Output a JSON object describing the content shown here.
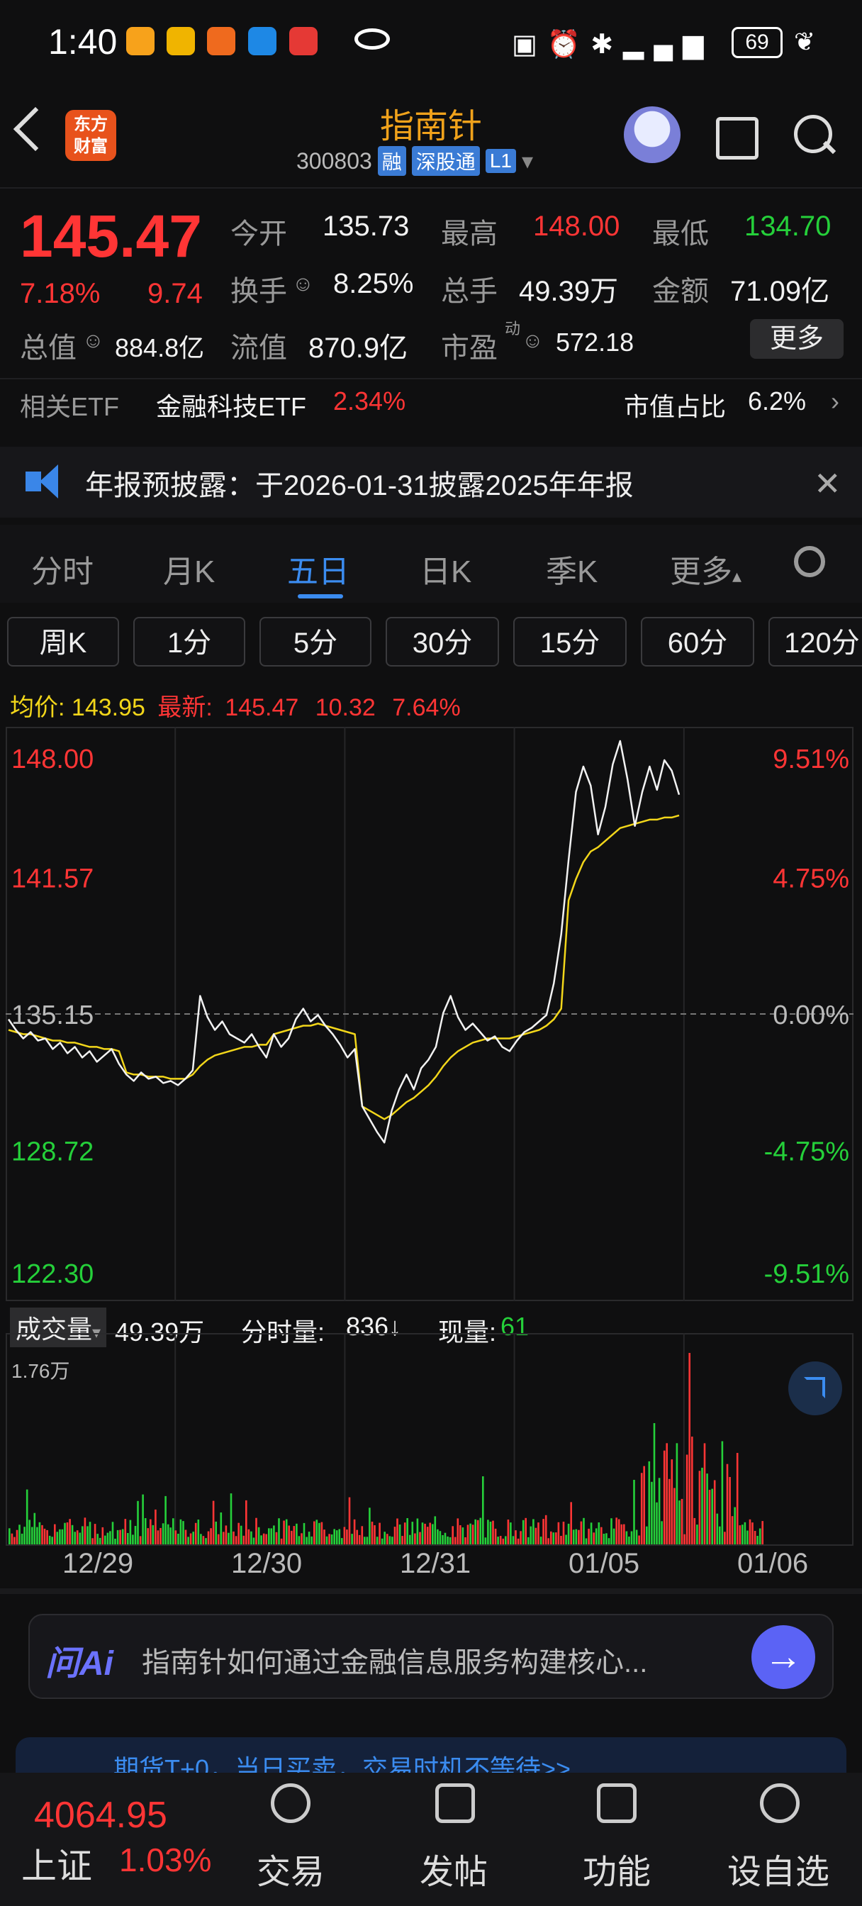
{
  "status_bar": {
    "time": "1:40",
    "battery": "69",
    "icons": [
      "nfc-icon",
      "alarm-icon",
      "bluetooth-icon",
      "signal-icon",
      "signal-icon",
      "leaf-icon"
    ]
  },
  "header": {
    "app_logo": "东方\n财富",
    "stock_name": "指南针",
    "stock_code": "300803",
    "tags": [
      "融",
      "深股通",
      "L1"
    ]
  },
  "quote": {
    "price": "145.47",
    "change_pct": "7.18%",
    "change": "9.74",
    "open_label": "今开",
    "open": "135.73",
    "high_label": "最高",
    "high": "148.00",
    "low_label": "最低",
    "low": "134.70",
    "turnover_label": "换手",
    "turnover": "8.25%",
    "volume_label": "总手",
    "volume": "49.39万",
    "amount_label": "金额",
    "amount": "71.09亿",
    "mcap_label": "总值",
    "mcap": "884.8亿",
    "float_label": "流值",
    "float": "870.9亿",
    "pe_label": "市盈",
    "pe_sup": "动",
    "pe": "572.18",
    "more": "更多"
  },
  "etf": {
    "label": "相关ETF",
    "name": "金融科技ETF",
    "pct": "2.34%",
    "share_label": "市值占比",
    "share": "6.2%"
  },
  "notice": {
    "text": "年报预披露：于2026-01-31披露2025年年报"
  },
  "tabs": [
    "分时",
    "月K",
    "五日",
    "日K",
    "季K",
    "更多"
  ],
  "active_tab": "五日",
  "periods": [
    "周K",
    "1分",
    "5分",
    "30分",
    "15分",
    "60分",
    "120分"
  ],
  "avg": {
    "avg_label": "均价:",
    "avg": "143.95",
    "latest_label": "最新:",
    "latest": "145.47",
    "chg": "10.32",
    "pct": "7.64%"
  },
  "chart_data": {
    "type": "line",
    "title": "",
    "price_ticks": [
      "148.00",
      "141.57",
      "135.15",
      "128.72",
      "122.30"
    ],
    "pct_ticks": [
      "9.51%",
      "4.75%",
      "0.00%",
      "-4.75%",
      "-9.51%"
    ],
    "ylim": [
      122.3,
      148.0
    ],
    "ref_price": 135.15,
    "days": [
      "12/29",
      "12/30",
      "12/31",
      "01/05",
      "01/06"
    ],
    "series": [
      {
        "values": [
          134.9,
          134.4,
          134.0,
          134.3,
          133.9,
          134.0,
          133.5,
          133.8,
          133.3,
          133.6,
          133.1,
          133.4,
          132.9,
          133.2,
          133.5,
          132.8,
          132.3,
          132.0,
          132.4,
          132.1,
          132.2,
          131.9,
          132.0,
          131.8,
          132.1,
          132.5,
          136.0,
          135.0,
          134.4,
          134.8,
          134.2,
          134.0,
          133.8,
          134.2,
          133.6,
          133.1,
          134.2,
          133.6,
          134.0,
          134.9,
          135.4,
          134.8,
          135.1,
          134.6,
          134.2,
          133.7,
          133.1,
          133.5,
          130.8,
          130.2,
          129.6,
          129.1,
          130.6,
          131.6,
          132.3,
          131.6,
          132.6,
          133.0,
          133.6,
          135.2,
          136.0,
          135.0,
          134.4,
          134.7,
          134.3,
          133.9,
          134.1,
          133.6,
          133.4,
          133.9,
          134.3,
          134.5,
          134.8,
          135.1,
          136.6,
          138.9,
          142.4,
          145.6,
          146.8,
          145.9,
          143.6,
          144.9,
          146.9,
          148.0,
          146.2,
          144.0,
          145.6,
          146.8,
          145.7,
          147.1,
          146.6,
          145.47
        ]
      },
      {
        "values": [
          134.4,
          134.3,
          134.2,
          134.2,
          134.1,
          134.0,
          133.9,
          133.9,
          133.8,
          133.8,
          133.7,
          133.6,
          133.6,
          133.5,
          133.5,
          133.4,
          132.4,
          132.3,
          132.3,
          132.2,
          132.2,
          132.2,
          132.1,
          132.1,
          132.1,
          132.3,
          132.7,
          133.0,
          133.2,
          133.3,
          133.4,
          133.5,
          133.6,
          133.6,
          133.7,
          133.7,
          134.2,
          134.3,
          134.4,
          134.5,
          134.6,
          134.6,
          134.7,
          134.6,
          134.5,
          134.4,
          134.3,
          134.2,
          130.8,
          130.6,
          130.4,
          130.2,
          130.4,
          130.7,
          131.0,
          131.2,
          131.5,
          131.8,
          132.2,
          132.7,
          133.1,
          133.4,
          133.6,
          133.8,
          133.9,
          134.0,
          134.0,
          134.0,
          134.0,
          134.1,
          134.2,
          134.3,
          134.4,
          134.6,
          134.9,
          135.4,
          140.5,
          141.5,
          142.3,
          142.8,
          143.0,
          143.3,
          143.6,
          143.9,
          144.0,
          144.1,
          144.2,
          144.3,
          144.3,
          144.4,
          144.4,
          144.5
        ]
      }
    ],
    "volume_max": "1.76万"
  },
  "volume": {
    "label": "成交量",
    "total": "49.39万",
    "tick_label": "分时量:",
    "tick": "836↓",
    "now_label": "现量:",
    "now": "61"
  },
  "ai": {
    "logo": "问Ai",
    "text": "指南针如何通过金融信息服务构建核心..."
  },
  "promo": {
    "text": "期货T+0，当日买卖，交易时机不等待>>"
  },
  "bottom": {
    "index_value": "4064.95",
    "index_name": "上证",
    "index_pct": "1.03%",
    "nav": [
      "交易",
      "发帖",
      "功能",
      "设自选"
    ]
  },
  "colors": {
    "up": "#ff3535",
    "down": "#25d03a",
    "accent": "#3b8cf0",
    "avg_line": "#f2d61a"
  }
}
